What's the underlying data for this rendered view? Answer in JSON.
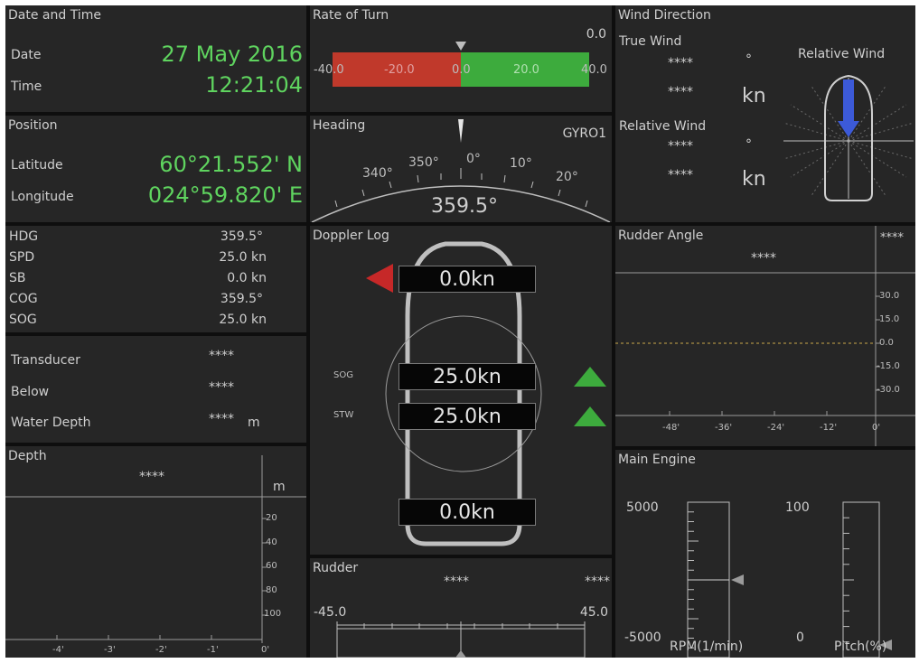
{
  "date_time": {
    "title": "Date and Time",
    "date_label": "Date",
    "date_value": "27 May 2016",
    "time_label": "Time",
    "time_value": "12:21:04"
  },
  "position": {
    "title": "Position",
    "lat_label": "Latitude",
    "lat_value": "60°21.552' N",
    "lon_label": "Longitude",
    "lon_value": "024°59.820' E"
  },
  "nav_list": {
    "rows": [
      {
        "label": "HDG",
        "value": "359.5°"
      },
      {
        "label": "SPD",
        "value": "25.0 kn"
      },
      {
        "label": "SB",
        "value": "0.0 kn"
      },
      {
        "label": "COG",
        "value": "359.5°"
      },
      {
        "label": "SOG",
        "value": "25.0 kn"
      }
    ]
  },
  "transducer": {
    "rows": [
      {
        "label": "Transducer",
        "value": "****"
      },
      {
        "label": "Below",
        "value": "****"
      },
      {
        "label": "Water Depth",
        "value": "****",
        "unit": "m"
      }
    ]
  },
  "depth": {
    "title": "Depth",
    "value": "****",
    "unit": "m",
    "y_ticks": [
      "20",
      "40",
      "60",
      "80",
      "100"
    ],
    "x_ticks": [
      "-4'",
      "-3'",
      "-2'",
      "-1'",
      "0'"
    ]
  },
  "rate_of_turn": {
    "title": "Rate of Turn",
    "value": "0.0",
    "scale": [
      "-40.0",
      "-20.0",
      "0.0",
      "20.0",
      "40.0"
    ],
    "pointer_value": 0.0,
    "range": [
      -40,
      40
    ]
  },
  "heading": {
    "title": "Heading",
    "source": "GYRO1",
    "value": "359.5°",
    "scale": [
      "340°",
      "350°",
      "0°",
      "10°",
      "20°"
    ]
  },
  "doppler": {
    "title": "Doppler Log",
    "bow_speed": "0.0kn",
    "sog_label": "SOG",
    "sog_value": "25.0kn",
    "stw_label": "STW",
    "stw_value": "25.0kn",
    "stern_speed": "0.0kn",
    "colors": {
      "arrow_red": "#c62828",
      "arrow_green": "#3dab3d"
    }
  },
  "rudder": {
    "title": "Rudder",
    "value_center": "****",
    "value_right": "****",
    "min_label": "-45.0",
    "max_label": "45.0"
  },
  "wind": {
    "title": "Wind Direction",
    "true_label": "True Wind",
    "true_dir": "****",
    "true_dir_unit": "°",
    "true_speed": "****",
    "true_speed_unit": "kn",
    "rel_label": "Relative Wind",
    "rel_dir": "****",
    "rel_dir_unit": "°",
    "rel_speed": "****",
    "rel_speed_unit": "kn",
    "diagram_label": "Relative Wind",
    "colors": {
      "arrow": "#3c5ad8"
    }
  },
  "rudder_angle": {
    "title": "Rudder Angle",
    "value_center": "****",
    "value_right": "****",
    "y_ticks": [
      "30.0",
      "15.0",
      "0.0",
      "-15.0",
      "-30.0"
    ],
    "x_ticks": [
      "-48'",
      "-36'",
      "-24'",
      "-12'",
      "0'"
    ]
  },
  "main_engine": {
    "title": "Main Engine",
    "rpm_max": "5000",
    "rpm_min": "-5000",
    "rpm_label": "RPM(1/min)",
    "pitch_max": "100",
    "pitch_min": "0",
    "pitch_label": "Pitch(%)",
    "rpm_value": 0,
    "pitch_value": 0
  },
  "colors": {
    "green_text": "#5fd45f",
    "rot_negative": "#c0392b",
    "rot_positive": "#3dab3d"
  }
}
